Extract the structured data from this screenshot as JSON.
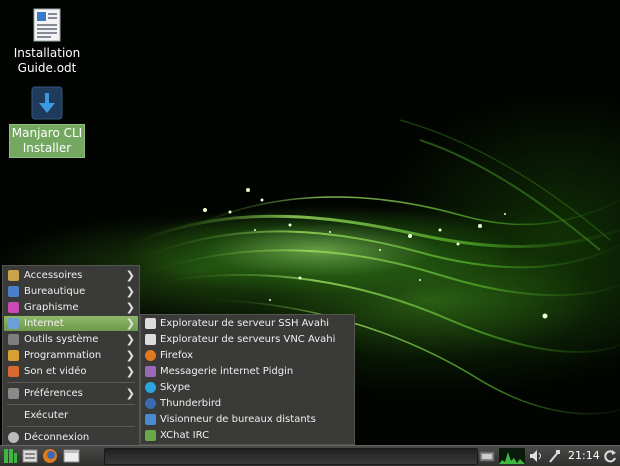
{
  "desktop": {
    "icons": [
      {
        "label_line1": "Installation",
        "label_line2": "Guide.odt",
        "icon": "document-icon"
      },
      {
        "label_line1": "Manjaro CLI",
        "label_line2": "Installer",
        "icon": "installer-icon"
      }
    ]
  },
  "menu": {
    "items": [
      {
        "label": "Accessoires",
        "icon": "accessories-icon",
        "color": "#c9a24a"
      },
      {
        "label": "Bureautique",
        "icon": "office-icon",
        "color": "#4a7fc9"
      },
      {
        "label": "Graphisme",
        "icon": "graphics-icon",
        "color": "#c94ab5"
      },
      {
        "label": "Internet",
        "icon": "internet-icon",
        "color": "#6a9fd8"
      },
      {
        "label": "Outils système",
        "icon": "system-tools-icon",
        "color": "#7f7f7f"
      },
      {
        "label": "Programmation",
        "icon": "programming-icon",
        "color": "#d8a030"
      },
      {
        "label": "Son et vidéo",
        "icon": "multimedia-icon",
        "color": "#d86a30"
      },
      {
        "label": "Préférences",
        "icon": "preferences-icon",
        "color": "#8a8a8a"
      },
      {
        "label": "Exécuter"
      },
      {
        "label": "Déconnexion",
        "icon": "logout-icon",
        "color": "#bbbbbb"
      }
    ],
    "arrow": "❯",
    "accent": "#7aa857"
  },
  "submenu": {
    "items": [
      {
        "label": "Explorateur de serveur SSH Avahi",
        "icon": "avahi-ssh-icon",
        "color": "#dddddd"
      },
      {
        "label": "Explorateur de serveurs VNC Avahi",
        "icon": "avahi-vnc-icon",
        "color": "#dddddd"
      },
      {
        "label": "Firefox",
        "icon": "firefox-icon",
        "color": "#e07a20"
      },
      {
        "label": "Messagerie internet Pidgin",
        "icon": "pidgin-icon",
        "color": "#9a6ab8"
      },
      {
        "label": "Skype",
        "icon": "skype-icon",
        "color": "#2aa5e0"
      },
      {
        "label": "Thunderbird",
        "icon": "thunderbird-icon",
        "color": "#3a6ab0"
      },
      {
        "label": "Visionneur de bureaux distants",
        "icon": "remote-desktop-icon",
        "color": "#4a8ad0"
      },
      {
        "label": "XChat IRC",
        "icon": "xchat-icon",
        "color": "#6aa84a"
      }
    ]
  },
  "panel": {
    "clock": "21:14",
    "colors": {
      "green": "#3fb63f"
    }
  }
}
